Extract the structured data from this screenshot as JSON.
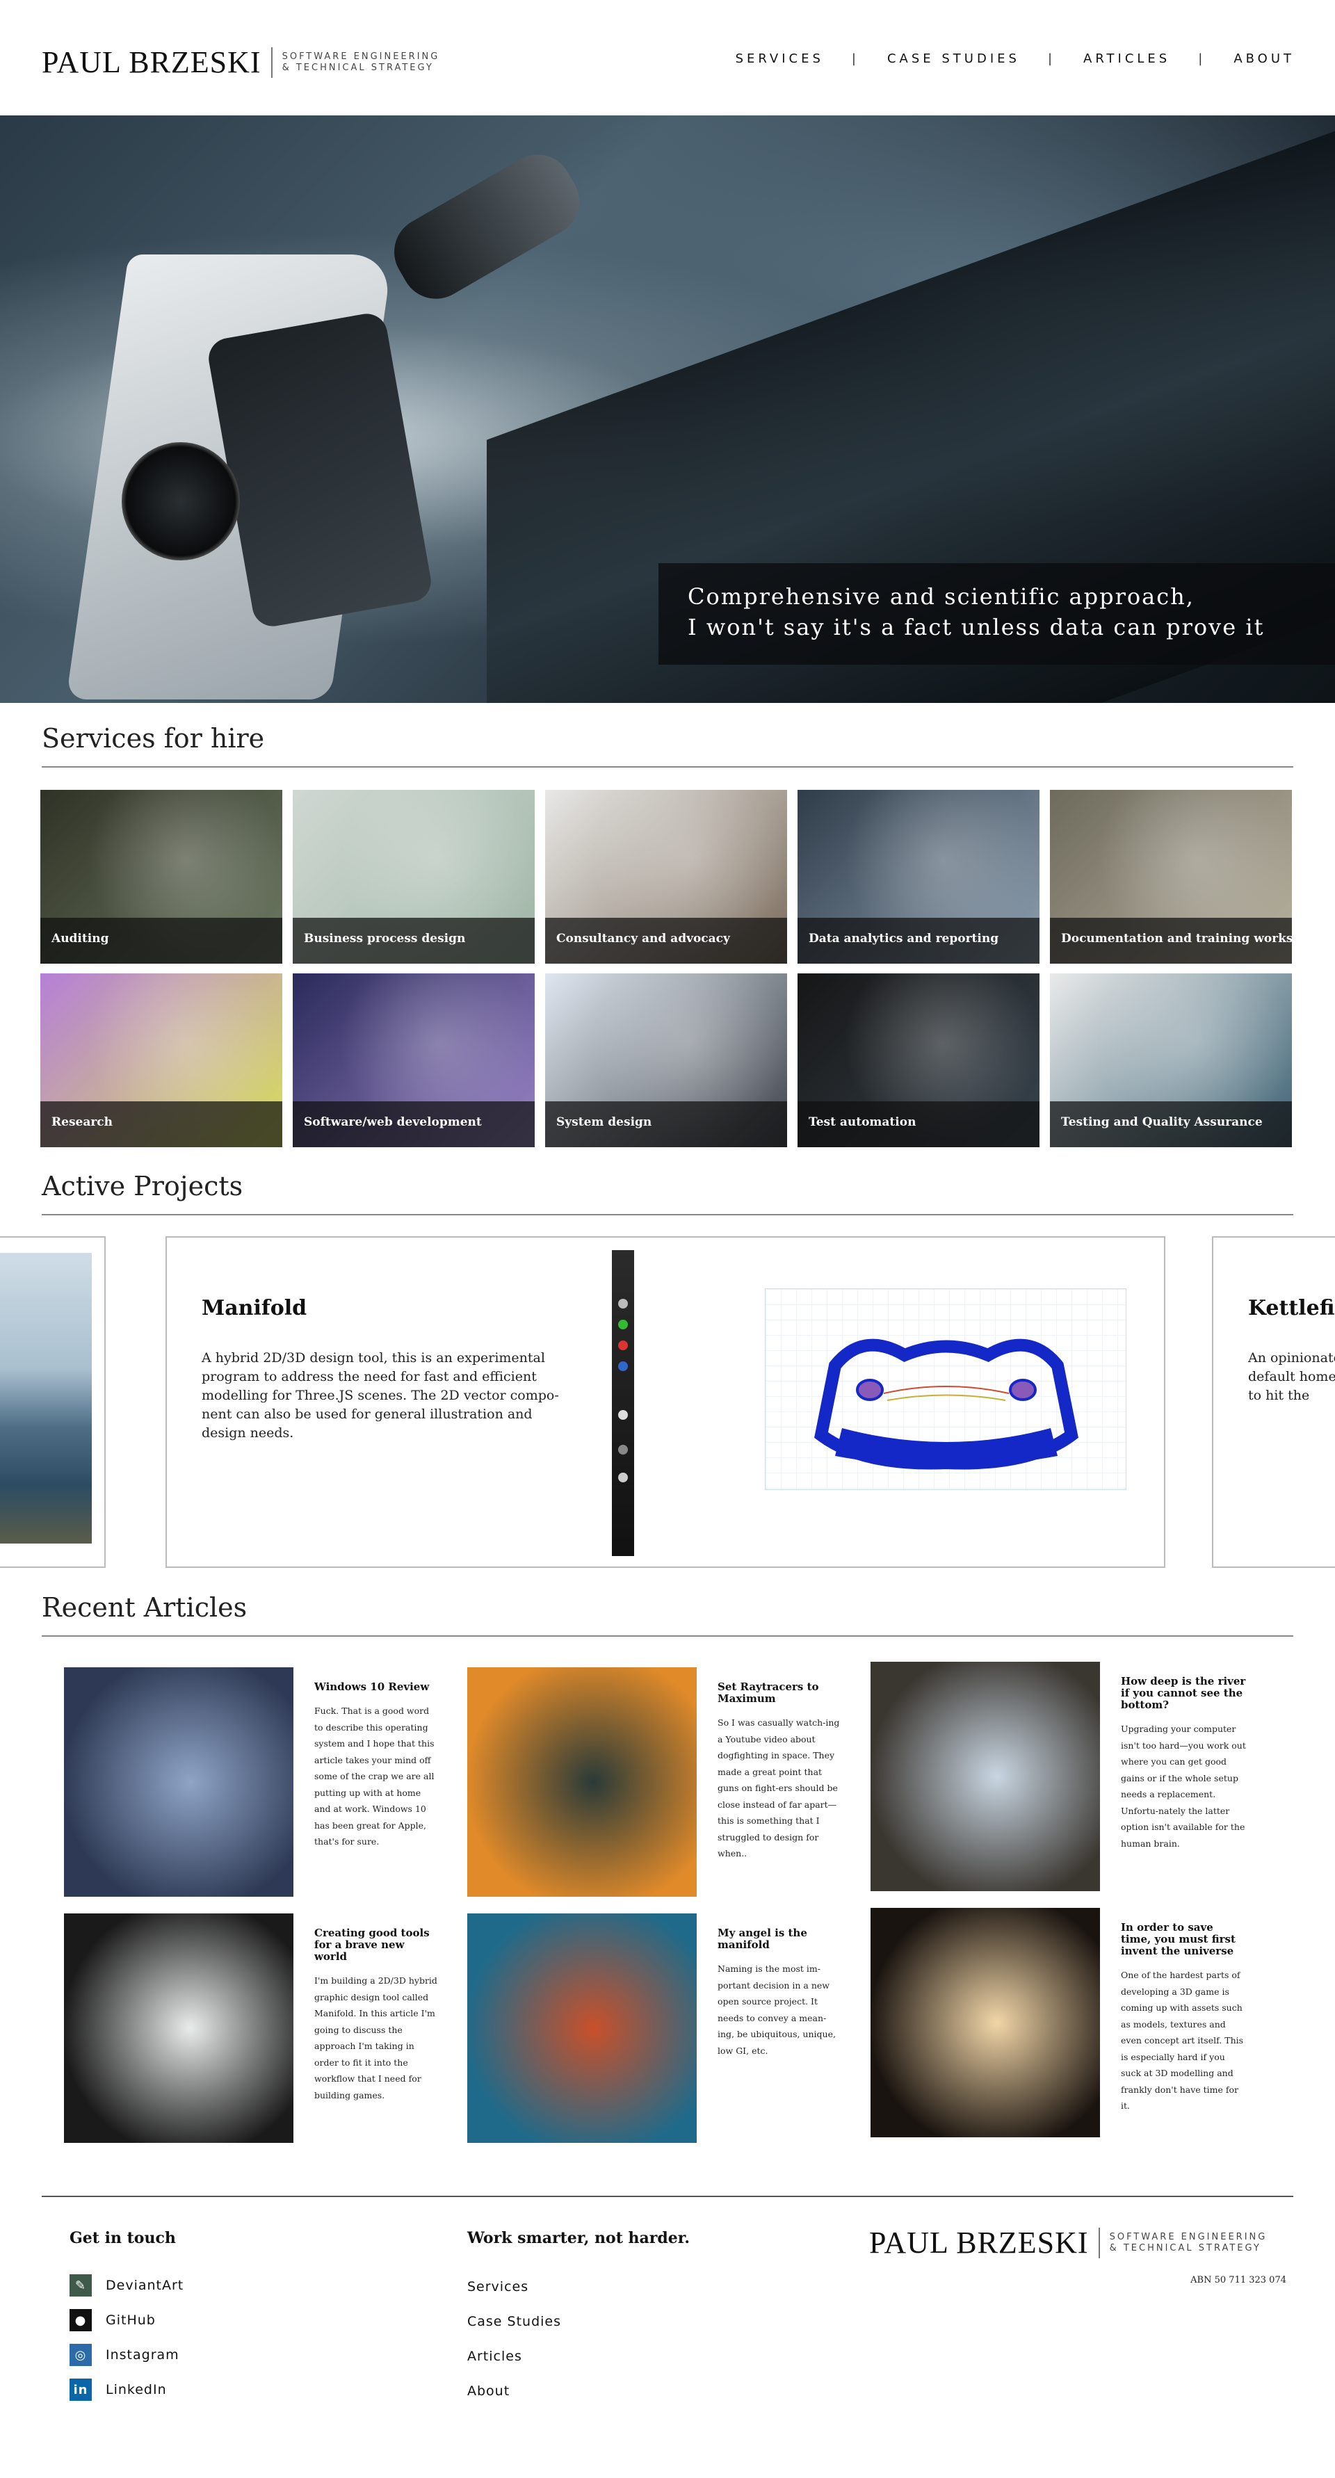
{
  "header": {
    "brand_name": "PAUL BRZESKI",
    "brand_tagline_1": "SOFTWARE ENGINEERING",
    "brand_tagline_2": "& TECHNICAL STRATEGY",
    "nav": [
      "SERVICES",
      "CASE STUDIES",
      "ARTICLES",
      "ABOUT"
    ]
  },
  "hero": {
    "caption_line_1": "Comprehensive and scientific approach,",
    "caption_line_2": "I won't say it's a fact unless data can prove it"
  },
  "services": {
    "title": "Services for hire",
    "items": [
      {
        "label": "Auditing",
        "colors": [
          "#2f3226",
          "#6e7a63"
        ]
      },
      {
        "label": "Business process design",
        "colors": [
          "#cfd8d2",
          "#9fb5a6"
        ]
      },
      {
        "label": "Consultancy and advocacy",
        "colors": [
          "#e8e8e6",
          "#7a6a5a"
        ]
      },
      {
        "label": "Data analytics and reporting",
        "colors": [
          "#2f3c4a",
          "#8ea0b0"
        ]
      },
      {
        "label": "Documentation and training workshops",
        "colors": [
          "#6e6a5c",
          "#b8b2a0"
        ]
      },
      {
        "label": "Research",
        "colors": [
          "#b67fd8",
          "#d8e05a"
        ]
      },
      {
        "label": "Software/web development",
        "colors": [
          "#2a2a5a",
          "#9a84c8"
        ]
      },
      {
        "label": "System design",
        "colors": [
          "#dfe6ef",
          "#3e434a"
        ]
      },
      {
        "label": "Test automation",
        "colors": [
          "#161616",
          "#38444e"
        ]
      },
      {
        "label": "Testing and Quality Assurance",
        "colors": [
          "#e9eaea",
          "#3b6173"
        ]
      }
    ]
  },
  "projects": {
    "title": "Active Projects",
    "main": {
      "title": "Manifold",
      "description": "A hybrid 2D/3D design tool, this is an experimental program to address the need for fast and efficient modelling for Three.JS scenes. The 2D vector compo-nent can also be used for general illustration and design needs."
    },
    "next": {
      "title": "Kettlefish",
      "description": "An opinionated (like this one default home ample, allowi are to hit the"
    }
  },
  "articles": {
    "title": "Recent Articles",
    "items": [
      {
        "title": "Windows 10 Review",
        "excerpt": "Fuck. That is a good word to describe this operating system and I hope that this article takes your mind off some of the crap we are all putting up with at home and at work. Windows 10 has been great for Apple, that's for sure.",
        "colors": [
          "#8fa4c6",
          "#2e3a55"
        ]
      },
      {
        "title": "Set Raytracers to Maximum",
        "excerpt": "So I was casually watch-ing a Youtube video about dogfighting in space. They made a great point that guns on fight-ers should be close instead of far apart—this is something that I struggled to design for when..",
        "colors": [
          "#2a3a38",
          "#e08a2a"
        ]
      },
      {
        "title": "How deep is the river if you cannot see the bottom?",
        "excerpt": "Upgrading your computer isn't too hard—you work out where you can get good gains or if the whole setup needs a replacement. Unfortu-nately the latter option isn't available for the human brain.",
        "colors": [
          "#c9d6e2",
          "#3a3630"
        ]
      },
      {
        "title": "Creating good tools for a brave new world",
        "excerpt": "I'm building a 2D/3D hybrid graphic design tool called Manifold. In this article I'm going to discuss the approach I'm taking in order to fit it into the workflow that I need for building games.",
        "colors": [
          "#e8ecea",
          "#1a1a1a"
        ]
      },
      {
        "title": "My angel is the manifold",
        "excerpt": "Naming is the most im-portant decision in a new open source project. It needs to convey a mean-ing, be ubiquitous, unique, low GI, etc.",
        "colors": [
          "#c9502a",
          "#1f6a8a"
        ]
      },
      {
        "title": "In order to save time, you must first invent the universe",
        "excerpt": "One of the hardest parts of developing a 3D game is coming up with assets such as models, textures and even concept art itself. This is especially hard if you suck at 3D modelling and frankly don't have time for it.",
        "colors": [
          "#f2d6a8",
          "#1a1410"
        ]
      }
    ]
  },
  "footer": {
    "contact_title": "Get in touch",
    "contacts": [
      {
        "label": "DeviantArt",
        "icon": "deviantart-icon",
        "color": "#3f5a4a"
      },
      {
        "label": "GitHub",
        "icon": "github-icon",
        "color": "#111111"
      },
      {
        "label": "Instagram",
        "icon": "instagram-icon",
        "color": "#2b6ca8"
      },
      {
        "label": "LinkedIn",
        "icon": "linkedin-icon",
        "color": "#0a66a8"
      }
    ],
    "slogan": "Work smarter, not harder.",
    "links": [
      "Services",
      "Case Studies",
      "Articles",
      "About"
    ],
    "brand_name": "PAUL BRZESKI",
    "brand_tagline_1": "SOFTWARE ENGINEERING",
    "brand_tagline_2": "& TECHNICAL STRATEGY",
    "abn": "ABN 50 711 323 074"
  }
}
